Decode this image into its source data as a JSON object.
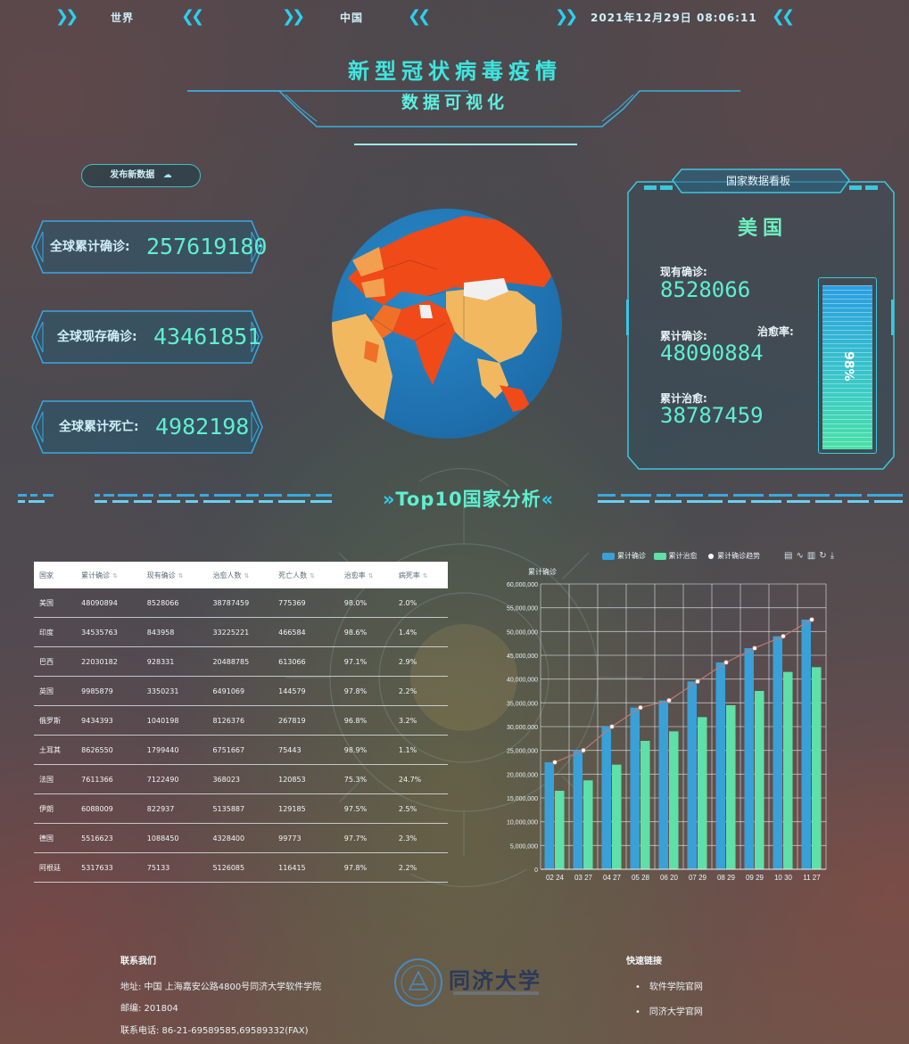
{
  "nav": {
    "world": "世界",
    "china": "中国",
    "datetime": "2021年12月29日  08:06:11"
  },
  "title": {
    "main": "新型冠状病毒疫情",
    "sub": "数据可视化"
  },
  "publish_button": "发布新数据",
  "stats": [
    {
      "label": "全球累计确诊:",
      "value": "257619180"
    },
    {
      "label": "全球现存确诊:",
      "value": "43461851"
    },
    {
      "label": "全球累计死亡:",
      "value": "4982198"
    }
  ],
  "board": {
    "title": "国家数据看板",
    "country": "美国",
    "current_label": "现有确诊:",
    "current_value": "8528066",
    "total_label": "累计确诊:",
    "total_value": "48090884",
    "recovered_label": "累计治愈:",
    "recovered_value": "38787459",
    "cure_rate_label": "治愈率:",
    "cure_rate_value": "98%",
    "cure_rate_fraction": 0.98
  },
  "section_title": "Top10国家分析",
  "table": {
    "headers": [
      "国家",
      "累计确诊",
      "现有确诊",
      "治愈人数",
      "死亡人数",
      "治愈率",
      "病死率"
    ],
    "rows": [
      [
        "美国",
        "48090894",
        "8528066",
        "38787459",
        "775369",
        "98.0%",
        "2.0%"
      ],
      [
        "印度",
        "34535763",
        "843958",
        "33225221",
        "466584",
        "98.6%",
        "1.4%"
      ],
      [
        "巴西",
        "22030182",
        "928331",
        "20488785",
        "613066",
        "97.1%",
        "2.9%"
      ],
      [
        "英国",
        "9985879",
        "3350231",
        "6491069",
        "144579",
        "97.8%",
        "2.2%"
      ],
      [
        "俄罗斯",
        "9434393",
        "1040198",
        "8126376",
        "267819",
        "96.8%",
        "3.2%"
      ],
      [
        "土耳其",
        "8626550",
        "1799440",
        "6751667",
        "75443",
        "98.9%",
        "1.1%"
      ],
      [
        "法国",
        "7611366",
        "7122490",
        "368023",
        "120853",
        "75.3%",
        "24.7%"
      ],
      [
        "伊朗",
        "6088009",
        "822937",
        "5135887",
        "129185",
        "97.5%",
        "2.5%"
      ],
      [
        "德国",
        "5516623",
        "1088450",
        "4328400",
        "99773",
        "97.7%",
        "2.3%"
      ],
      [
        "阿根廷",
        "5317633",
        "75133",
        "5126085",
        "116415",
        "97.8%",
        "2.2%"
      ]
    ]
  },
  "chart_data": {
    "type": "bar",
    "ylabel": "累计确诊",
    "ylim": [
      0,
      60000000
    ],
    "yticks": [
      "0",
      "5,000,000",
      "10,000,000",
      "15,000,000",
      "20,000,000",
      "25,000,000",
      "30,000,000",
      "35,000,000",
      "40,000,000",
      "45,000,000",
      "50,000,000",
      "55,000,000",
      "60,000,000"
    ],
    "categories": [
      "02 24",
      "03 27",
      "04 27",
      "05 28",
      "06 20",
      "07 29",
      "08 29",
      "09 29",
      "10 30",
      "11 27"
    ],
    "series": [
      {
        "name": "累计确诊",
        "type": "bar",
        "color": "#3aa0d8",
        "values": [
          22500000,
          25000000,
          30000000,
          34000000,
          35500000,
          39500000,
          43500000,
          46500000,
          49000000,
          52500000
        ]
      },
      {
        "name": "累计治愈",
        "type": "bar",
        "color": "#5ee0a8",
        "values": [
          16500000,
          18700000,
          22000000,
          27000000,
          29000000,
          32000000,
          34500000,
          37500000,
          41500000,
          42500000
        ]
      },
      {
        "name": "累计确诊趋势",
        "type": "line",
        "color": "#f0f0f0",
        "values": [
          22500000,
          25000000,
          30000000,
          34000000,
          35500000,
          39500000,
          43500000,
          46500000,
          49000000,
          52500000
        ]
      }
    ],
    "grid": true,
    "legend": "top-right"
  },
  "footer": {
    "contact_title": "联系我们",
    "address": "地址:  中国 上海嘉安公路4800号同济大学软件学院",
    "postcode": "邮编:  201804",
    "phone": "联系电话:  86-21-69589585,69589332(FAX)",
    "logo_text": "同济大学",
    "links_title": "快速链接",
    "links": [
      "软件学院官网",
      "同济大学官网"
    ]
  },
  "colors": {
    "accent": "#2ad0f0",
    "value": "#5ef0d0",
    "confirmed": "#3aa0d8",
    "recovered": "#5ee0a8"
  }
}
